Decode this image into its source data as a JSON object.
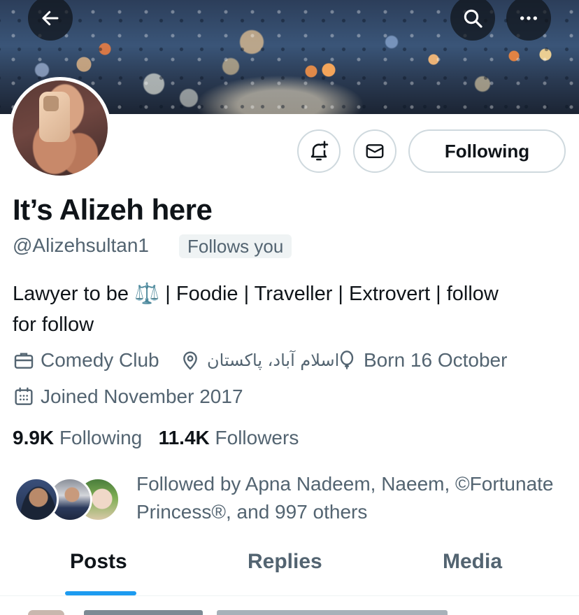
{
  "header": {
    "back_icon": "arrow-left-icon",
    "search_icon": "search-icon",
    "more_icon": "more-horizontal-icon",
    "overlay_color": "#0f1419"
  },
  "profile": {
    "display_name": "It’s Alizeh here",
    "handle": "@Alizehsultan1",
    "follows_you_badge": "Follows you",
    "bio_line1": "Lawyer to be ⚖️ | Foodie | Traveller | Extrovert | follow",
    "bio_line2": "for follow",
    "category": "Comedy Club",
    "location": "اسلام آباد، پاکستان",
    "birthday": "Born 16 October",
    "joined": "Joined November 2017"
  },
  "actions": {
    "notify_icon": "bell-plus-icon",
    "message_icon": "envelope-icon",
    "following_label": "Following"
  },
  "stats": {
    "following_count": "9.9K",
    "following_label": "Following",
    "followers_count": "11.4K",
    "followers_label": "Followers"
  },
  "followed_by": {
    "text": "Followed by Apna Nadeem, Naeem, ©Fortunate Princess®, and 997 others"
  },
  "tabs": [
    {
      "label": "Posts",
      "active": true
    },
    {
      "label": "Replies",
      "active": false
    },
    {
      "label": "Media",
      "active": false
    }
  ],
  "colors": {
    "accent": "#1d9bf0",
    "secondary_text": "#536471",
    "primary_text": "#0f1419",
    "border": "#cfd9de"
  }
}
